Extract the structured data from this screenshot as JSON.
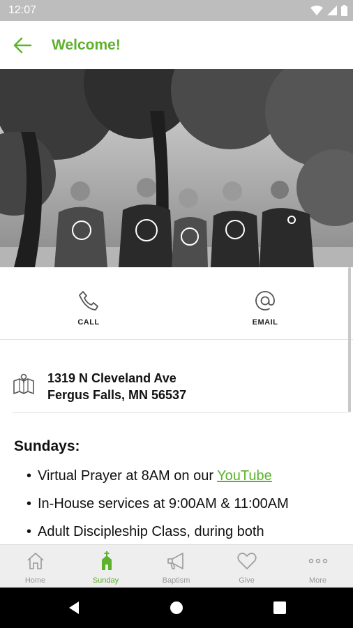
{
  "status_bar": {
    "time": "12:07"
  },
  "header": {
    "title": "Welcome!"
  },
  "actions": [
    {
      "label": "CALL",
      "icon": "phone-icon"
    },
    {
      "label": "EMAIL",
      "icon": "at-sign-icon"
    }
  ],
  "address": {
    "line1": "1319 N Cleveland Ave",
    "line2": "Fergus Falls, MN 56537"
  },
  "schedule": {
    "heading": "Sundays:",
    "items": [
      {
        "prefix": "Virtual Prayer at 8AM on our ",
        "link": "YouTube"
      },
      {
        "text": "In-House services at 9:00AM & 11:00AM"
      },
      {
        "text": "Adult Discipleship Class, during both"
      }
    ]
  },
  "tabs": [
    {
      "label": "Home",
      "icon": "home-icon"
    },
    {
      "label": "Sunday",
      "icon": "church-icon",
      "active": true
    },
    {
      "label": "Baptism",
      "icon": "megaphone-icon"
    },
    {
      "label": "Give",
      "icon": "heart-icon"
    },
    {
      "label": "More",
      "icon": "more-dots-icon"
    }
  ],
  "colors": {
    "accent": "#5db22c",
    "tab_bar": "#eeeeee",
    "status_bar": "#bdbdbd"
  }
}
